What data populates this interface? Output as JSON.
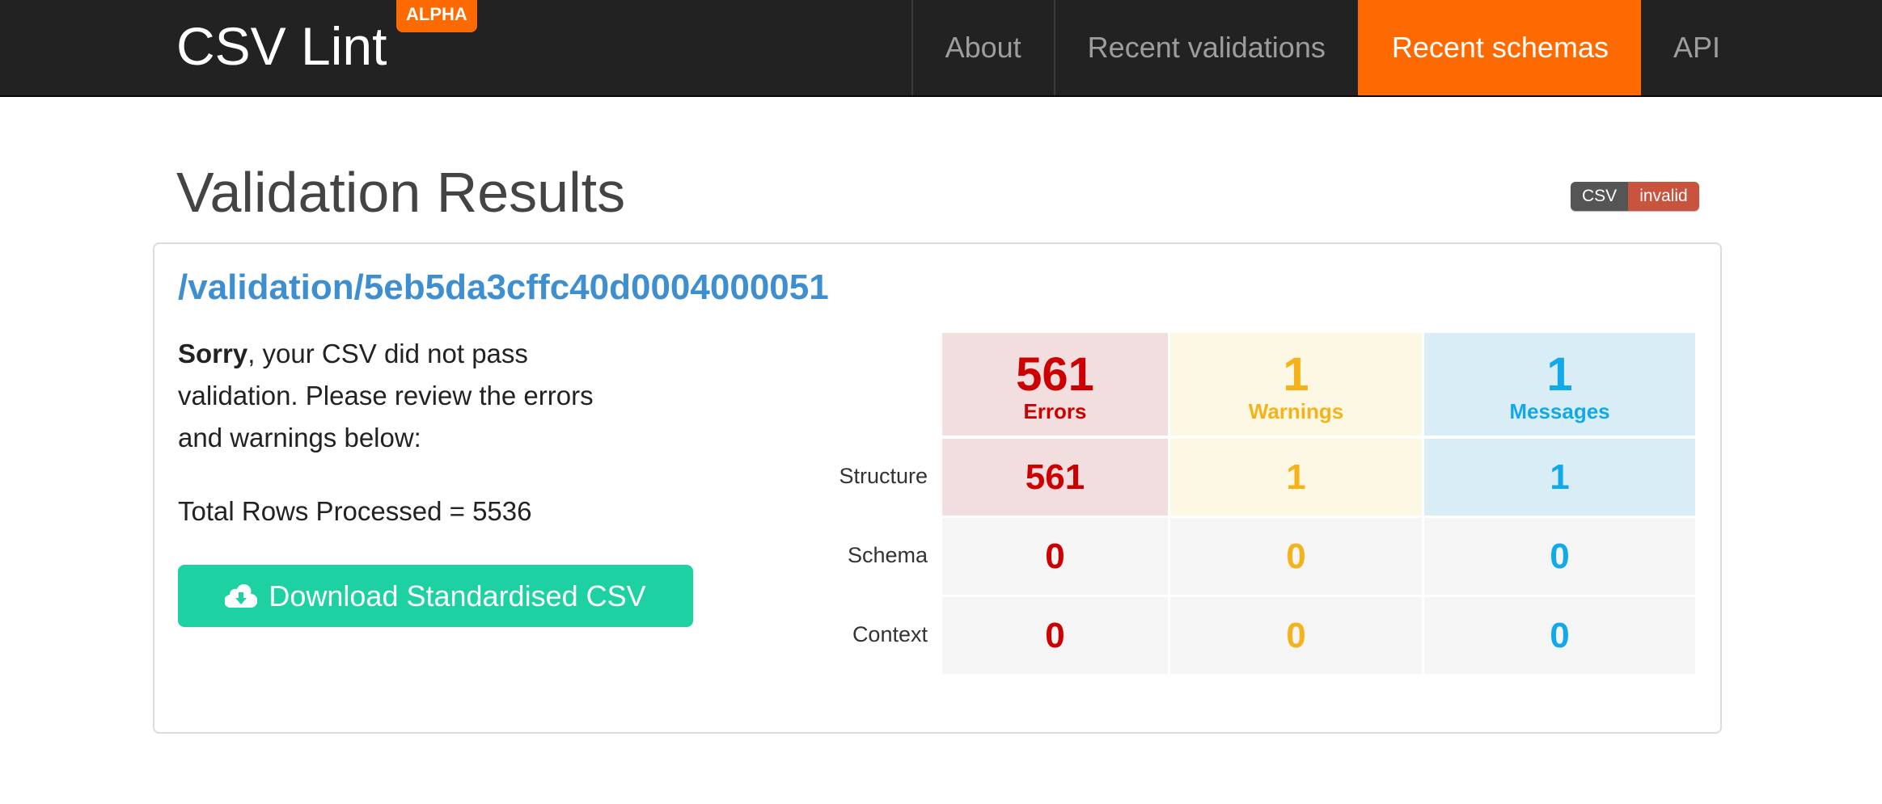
{
  "nav": {
    "brand": "CSV Lint",
    "badge": "ALPHA",
    "items": [
      {
        "label": "About"
      },
      {
        "label": "Recent validations"
      },
      {
        "label": "Recent schemas"
      },
      {
        "label": "API"
      }
    ],
    "active_item": "Recent schemas",
    "active_color": "#ff6a00"
  },
  "header": {
    "title": "Validation Results",
    "status_badge": {
      "left": "CSV",
      "right": "invalid"
    }
  },
  "panel": {
    "link": "/validation/5eb5da3cffc40d0004000051",
    "message_bold": "Sorry",
    "message_rest": ", your CSV did not pass validation. Please review the errors and warnings below:",
    "total_rows": "Total Rows Processed = 5536",
    "download_label": "Download Standardised CSV",
    "download_icon": "cloud-download-icon"
  },
  "summary": {
    "totals": {
      "errors": {
        "count": "561",
        "label": "Errors"
      },
      "warnings": {
        "count": "1",
        "label": "Warnings"
      },
      "messages": {
        "count": "1",
        "label": "Messages"
      }
    },
    "rows": [
      {
        "label": "Structure",
        "errors": "561",
        "warnings": "1",
        "messages": "1"
      },
      {
        "label": "Schema",
        "errors": "0",
        "warnings": "0",
        "messages": "0"
      },
      {
        "label": "Context",
        "errors": "0",
        "warnings": "0",
        "messages": "0"
      }
    ],
    "colors": {
      "errors": "#cc0000",
      "warnings": "#f6b21a",
      "messages": "#12a9e8"
    }
  }
}
